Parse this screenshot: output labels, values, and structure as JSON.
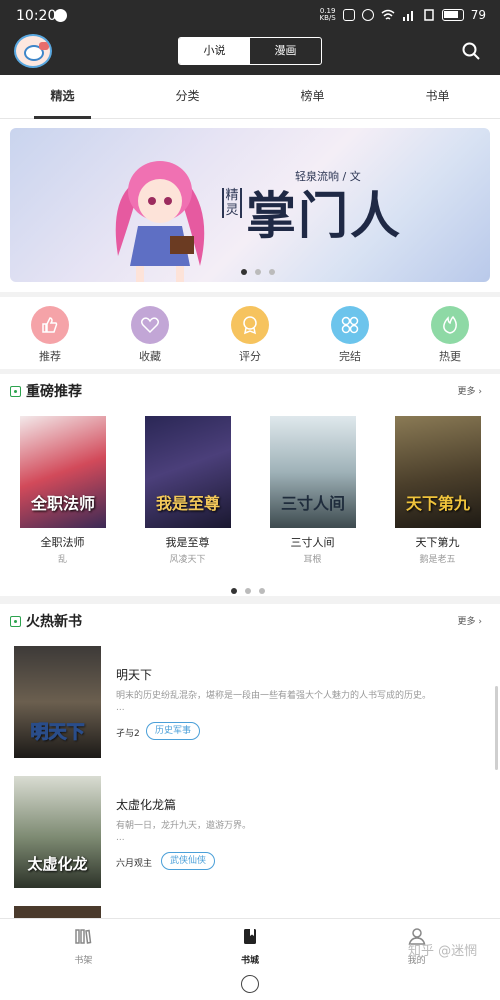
{
  "status_bar": {
    "time": "10:20",
    "net_speed_value": "0.19",
    "net_speed_unit": "KB/S",
    "battery": "79"
  },
  "header": {
    "segments": [
      {
        "label": "小说",
        "active": true
      },
      {
        "label": "漫画",
        "active": false
      }
    ]
  },
  "tabs": [
    {
      "label": "精选",
      "active": true
    },
    {
      "label": "分类",
      "active": false
    },
    {
      "label": "榜单",
      "active": false
    },
    {
      "label": "书单",
      "active": false
    }
  ],
  "banner": {
    "author": "轻泉流响 / 文",
    "genre": "精灵",
    "title": "掌门人",
    "page_count": 3,
    "current_page": 1
  },
  "categories": [
    {
      "label": "推荐",
      "icon": "thumbs-up-icon",
      "color": "#f5a3a8"
    },
    {
      "label": "收藏",
      "icon": "heart-icon",
      "color": "#c2a6d6"
    },
    {
      "label": "评分",
      "icon": "rating-badge-icon",
      "color": "#f6c35e"
    },
    {
      "label": "完结",
      "icon": "grid-flower-icon",
      "color": "#6cc4ec"
    },
    {
      "label": "热更",
      "icon": "flame-icon",
      "color": "#8ed9a5"
    }
  ],
  "featured": {
    "title": "重磅推荐",
    "more": "更多",
    "books": [
      {
        "name": "全职法师",
        "author": "乱",
        "cover_text": "全职法师"
      },
      {
        "name": "我是至尊",
        "author": "风凌天下",
        "cover_text": "我是至尊"
      },
      {
        "name": "三寸人间",
        "author": "耳根",
        "cover_text": "三寸人间"
      },
      {
        "name": "天下第九",
        "author": "鹅是老五",
        "cover_text": "天下第九"
      }
    ],
    "page_count": 3,
    "current_page": 1
  },
  "new_books": {
    "title": "火热新书",
    "more": "更多",
    "items": [
      {
        "title": "明天下",
        "desc": "明末的历史纷乱混杂，堪称是一段由一些有着强大个人魅力的人书写成的历史。",
        "ellipsis": "...",
        "author": "孑与2",
        "tag": "历史军事",
        "cover_text": "明天下"
      },
      {
        "title": "太虚化龙篇",
        "desc": "有朝一日，龙升九天，遨游万界。",
        "ellipsis": "...",
        "author": "六月观主",
        "tag": "武侠仙侠",
        "cover_text": "太虚化龙"
      }
    ]
  },
  "bottom_nav": [
    {
      "label": "书架",
      "icon": "bookshelf-icon",
      "active": false
    },
    {
      "label": "书城",
      "icon": "bookstore-icon",
      "active": true
    },
    {
      "label": "我的",
      "icon": "user-icon",
      "active": false
    }
  ],
  "watermark": "知乎 @迷惘"
}
